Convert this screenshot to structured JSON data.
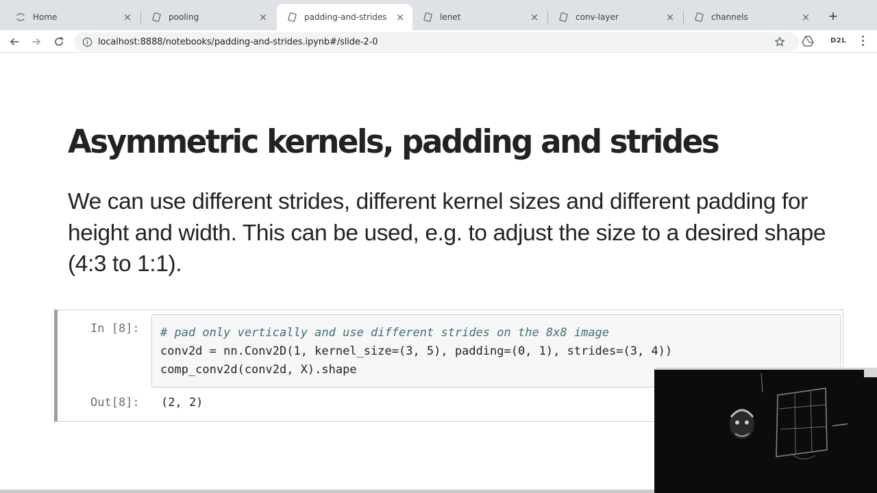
{
  "browser": {
    "tabs": [
      {
        "label": "Home",
        "favicon": "jupyter-logo-icon",
        "active": false
      },
      {
        "label": "pooling",
        "favicon": "notebook-icon",
        "active": false
      },
      {
        "label": "padding-and-strides",
        "favicon": "notebook-icon",
        "active": true
      },
      {
        "label": "lenet",
        "favicon": "notebook-icon",
        "active": false
      },
      {
        "label": "conv-layer",
        "favicon": "notebook-icon",
        "active": false
      },
      {
        "label": "channels",
        "favicon": "notebook-icon",
        "active": false
      }
    ],
    "new_tab_icon": "plus-icon",
    "url": "localhost:8888/notebooks/padding-and-strides.ipynb#/slide-2-0",
    "extensions": {
      "d2l_label": "D2L"
    }
  },
  "slide": {
    "title": "Asymmetric kernels, padding and strides",
    "body": "We can use different strides, different kernel sizes and different padding for height and width. This can be used, e.g. to adjust the size to a desired shape (4:3 to 1:1)."
  },
  "cell": {
    "in_prompt": "In [8]:",
    "out_prompt": "Out[8]:",
    "code_lines": [
      "# pad only vertically and use different strides on the 8x8 image",
      "conv2d = nn.Conv2D(1, kernel_size=(3, 5), padding=(0, 1), strides=(3, 4))",
      "comp_conv2d(conv2d, X).shape"
    ],
    "output": "(2, 2)"
  },
  "colors": {
    "tabstrip_bg": "#dee1e6",
    "omnibox_bg": "#f1f3f4",
    "text": "#222222",
    "comment": "#3d6e7a",
    "prompt": "#6e6e6e",
    "cell_input_bg": "#f7f7f7"
  }
}
